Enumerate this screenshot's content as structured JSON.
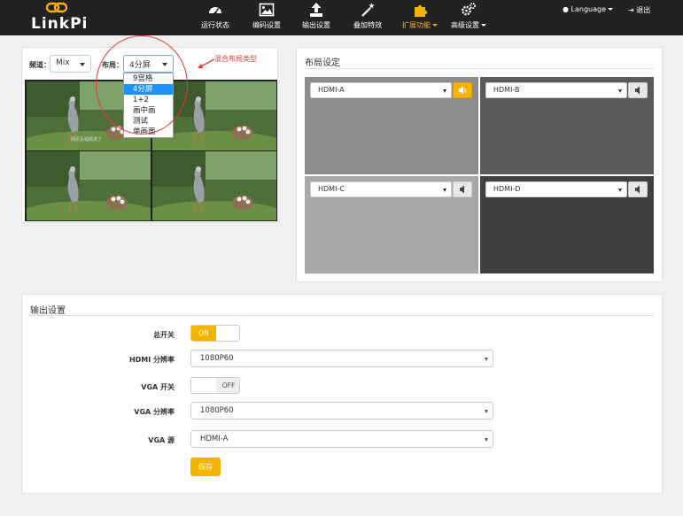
{
  "brand": {
    "name": "LinkPi"
  },
  "nav": {
    "items": [
      {
        "label": "运行状态"
      },
      {
        "label": "编码设置"
      },
      {
        "label": "输出设置"
      },
      {
        "label": "叠加特效"
      },
      {
        "label": "扩展功能"
      },
      {
        "label": "高级设置"
      }
    ],
    "language": "Language",
    "logout": "退出"
  },
  "preview": {
    "channel_label": "频道：",
    "channel_value": "Mix",
    "layout_label": "布局：",
    "layout_value": "4分屏",
    "layout_options": [
      "9宫格",
      "4分屏",
      "1+2",
      "画中画",
      "测试",
      "单画面"
    ],
    "annotation": "混合布局类型",
    "watermark": "网页及视频流了"
  },
  "layout_panel": {
    "title": "布局设定",
    "cells": [
      {
        "source": "HDMI-A"
      },
      {
        "source": "HDMI-B"
      },
      {
        "source": "HDMI-C"
      },
      {
        "source": "HDMI-D"
      }
    ]
  },
  "output_panel": {
    "title": "输出设置",
    "master_switch_label": "总开关",
    "master_switch_on": "ON",
    "hdmi_res_label": "HDMI 分辨率",
    "hdmi_res_value": "1080P60",
    "vga_switch_label": "VGA 开关",
    "vga_switch_off": "OFF",
    "vga_res_label": "VGA 分辨率",
    "vga_res_value": "1080P60",
    "vga_src_label": "VGA 源",
    "vga_src_value": "HDMI-A",
    "save_label": "保存"
  },
  "colors": {
    "accent": "#f5b400",
    "navbar": "#222222",
    "selected_option": "#1e90ff",
    "annotation": "#e53935",
    "cell_a": "#8c8c8c",
    "cell_b": "#5a5a5a",
    "cell_c": "#a8a8a8",
    "cell_d": "#404040"
  }
}
